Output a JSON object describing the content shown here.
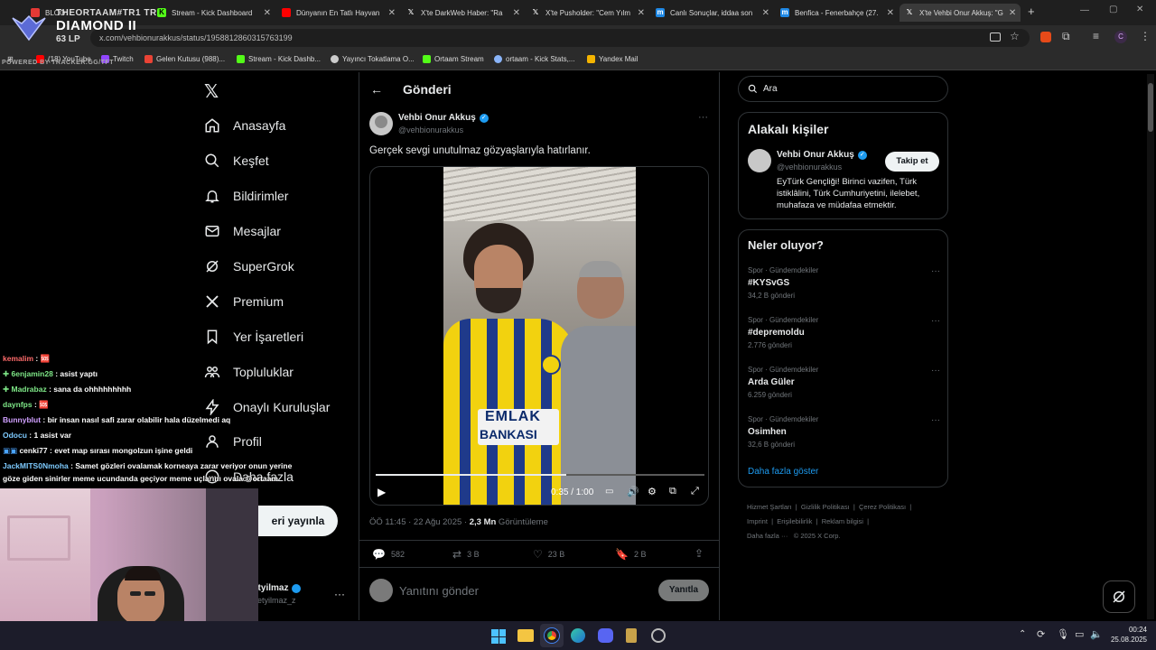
{
  "browser": {
    "tabs": [
      {
        "label": "BLOG",
        "fav_color": "#e53935"
      },
      {
        "label": "Stream - Kick Dashboard",
        "fav_color": "#53fc18"
      },
      {
        "label": "Dünyanın En Tatlı Hayvan",
        "fav_color": "#ff0000"
      },
      {
        "label": "X'te DarkWeb Haber: \"Ra",
        "fav_color": "#ffffff"
      },
      {
        "label": "X'te Pusholder: \"Cem Yılm",
        "fav_color": "#ffffff"
      },
      {
        "label": "Canlı Sonuçlar, iddaa son",
        "fav_color": "#1e88e5"
      },
      {
        "label": "Benfica - Fenerbahçe (27.",
        "fav_color": "#1e88e5"
      },
      {
        "label": "X'te Vehbi Onur Akkuş: \"G",
        "fav_color": "#ffffff"
      }
    ],
    "url": "x.com/vehbionurakkus/status/1958812860315763199",
    "bookmarks": [
      {
        "label": "(18) YouTube",
        "color": "#ff0000"
      },
      {
        "label": "Twitch",
        "color": "#9146ff"
      },
      {
        "label": "Gelen Kutusu (988)...",
        "color": "#ea4335"
      },
      {
        "label": "Stream - Kick Dashb...",
        "color": "#53fc18"
      },
      {
        "label": "Yayıncı Tokatlama O...",
        "color": "#cccccc"
      },
      {
        "label": "Ortaam Stream",
        "color": "#53fc18"
      },
      {
        "label": "ortaam - Kick Stats,...",
        "color": "#8ab4f8"
      },
      {
        "label": "Yandex Mail",
        "color": "#f4b400"
      }
    ]
  },
  "overlay": {
    "team": "THEORTAAM#TR1 TR",
    "rank": "DIAMOND II",
    "lp": "63 LP",
    "powered": "POWERED BY TRACKER.GG/TFT"
  },
  "nav": {
    "items": [
      "Anasayfa",
      "Keşfet",
      "Bildirimler",
      "Mesajlar",
      "SuperGrok",
      "Premium",
      "Yer İşaretleri",
      "Topluluklar",
      "Onaylı Kuruluşlar",
      "Profil",
      "Daha fazla"
    ],
    "post_button": "eri yayınla",
    "account_name": "etyilmaz",
    "account_handle": "netyilmaz_z"
  },
  "post": {
    "header_title": "Gönderi",
    "author_name": "Vehbi Onur Akkuş",
    "author_handle": "@vehbionurakkus",
    "text": "Gerçek sevgi unutulmaz gözyaşlarıyla hatırlanır.",
    "video_time": "0:35 / 1:00",
    "video_progress": 0.58,
    "date": "ÖÖ 11:45 · 22 Ağu 2025 · ",
    "views": "2,3 Mn",
    "views_label": " Görüntüleme",
    "replies": "582",
    "reposts": "3 B",
    "likes": "23 B",
    "bookmarks": "2 B",
    "reply_placeholder": "Yanıtını gönder",
    "reply_button": "Yanıtla"
  },
  "jersey": {
    "sponsor_line1": "EMLAK",
    "sponsor_line2": "BANKASI"
  },
  "search": {
    "placeholder": "Ara"
  },
  "related": {
    "title": "Alakalı kişiler",
    "name": "Vehbi Onur Akkuş",
    "handle": "@vehbionurakkus",
    "follow": "Takip et",
    "bio": "EyTürk Gençliği! Birinci vazifen, Türk istiklâlini, Türk Cumhuriyetini, ilelebet, muhafaza ve müdafaa etmektir."
  },
  "trends": {
    "title": "Neler oluyor?",
    "items": [
      {
        "category": "Spor · Gündemdekiler",
        "name": "#KYSvGS",
        "count": "34,2 B gönderi"
      },
      {
        "category": "Spor · Gündemdekiler",
        "name": "#depremoldu",
        "count": "2.776 gönderi"
      },
      {
        "category": "Spor · Gündemdekiler",
        "name": "Arda Güler",
        "count": "6.259 gönderi"
      },
      {
        "category": "Spor · Gündemdekiler",
        "name": "Osimhen",
        "count": "32,6 B gönderi"
      }
    ],
    "show_more": "Daha fazla göster"
  },
  "footer": {
    "links": [
      "Hizmet Şartları",
      "Gizlilik Politikası",
      "Çerez Politikası",
      "Imprint",
      "Erişilebilirlik",
      "Reklam bilgisi",
      "Daha fazla ···",
      "© 2025 X Corp."
    ]
  },
  "chat": [
    {
      "user": "kemalim",
      "msg": ": 🆘",
      "color": "#ff6b6b"
    },
    {
      "user": "6enjamin28",
      "msg": ": asist yaptı",
      "color": "#7ee787"
    },
    {
      "user": "Madrabaz",
      "msg": ": sana da ohhhhhhhhh",
      "color": "#7ee787"
    },
    {
      "user": "daynfps",
      "msg": ": 🆘",
      "color": "#7ee787"
    },
    {
      "user": "Bunnyblut",
      "msg": ": bir insan nasıl safi zarar olabilir hala düzelmedi aq",
      "color": "#d0a0ff"
    },
    {
      "user": "Odocu",
      "msg": ": 1 asist var",
      "color": "#7ecbff"
    },
    {
      "user": "cenki77",
      "msg": ": evet map sırası mongolzun işine geldi",
      "color": "#ffffff"
    },
    {
      "user": "JackMITS0Nmoha",
      "msg": ": Samet gözleri ovalamak korneaya zarar veriyor onun yerine",
      "color": "#7ecbff"
    },
    {
      "user": "",
      "msg": "göze giden sinirler meme ucundanda geçiyor meme uçlarını ovala @ortaam",
      "color": "#ffffff"
    }
  ],
  "taskbar": {
    "time": "00:24",
    "date": "25.08.2025"
  },
  "colors": {
    "accent": "#1d9bf0",
    "verified": "#1d9bf0",
    "muted": "#71767b",
    "border": "#2f3336"
  }
}
